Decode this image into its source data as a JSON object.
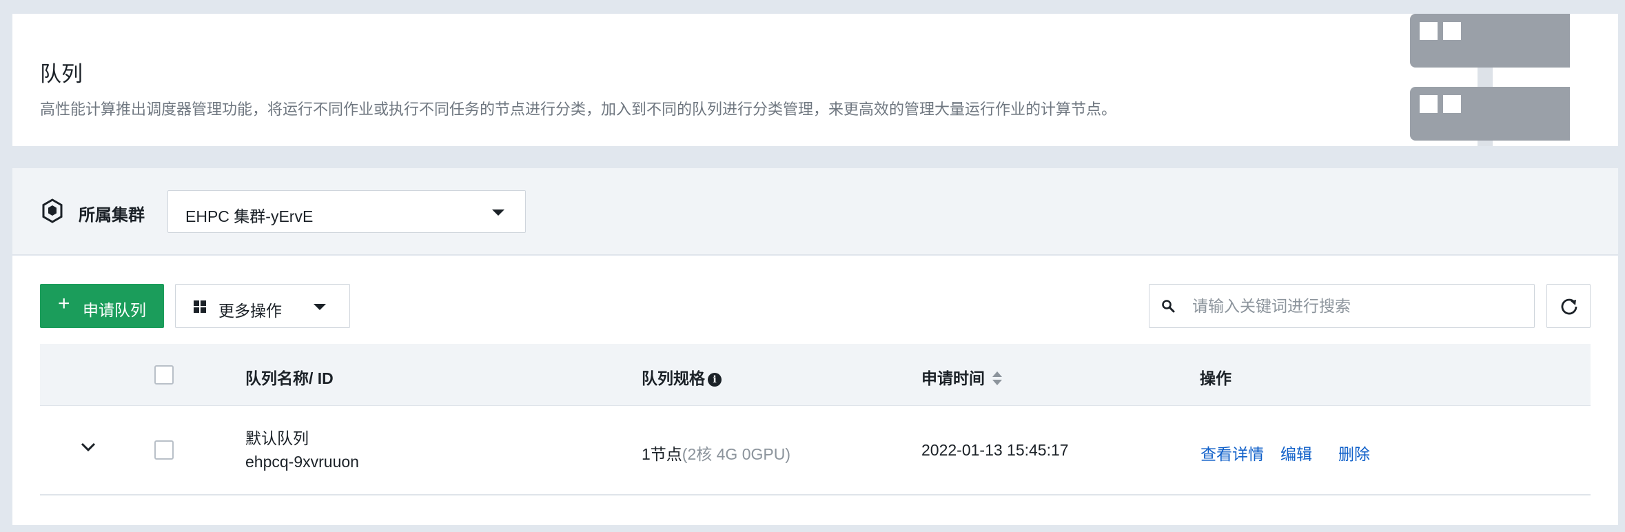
{
  "banner": {
    "title": "队列",
    "description": "高性能计算推出调度器管理功能，将运行不同作业或执行不同任务的节点进行分类，加入到不同的队列进行分类管理，来更高效的管理大量运行作业的计算节点。"
  },
  "cluster": {
    "label": "所属集群",
    "selected": "EHPC 集群-yErvE",
    "icon": "cube-icon"
  },
  "toolbar": {
    "apply_label": "申请队列",
    "more_label": "更多操作",
    "search_placeholder": "请输入关键词进行搜索",
    "search_value": ""
  },
  "table": {
    "headers": {
      "name": "队列名称/ ID",
      "spec": "队列规格",
      "time": "申请时间",
      "actions": "操作"
    },
    "rows": [
      {
        "name": "默认队列",
        "id": "ehpcq-9xvruuon",
        "nodes": "1节点",
        "spec_detail": "(2核 4G 0GPU)",
        "time": "2022-01-13 15:45:17",
        "actions": [
          "查看详情",
          "编辑",
          "删除"
        ]
      }
    ]
  },
  "colors": {
    "primary": "#1b9d5b",
    "link": "#1060c9",
    "page_bg": "#e1e7ee"
  }
}
